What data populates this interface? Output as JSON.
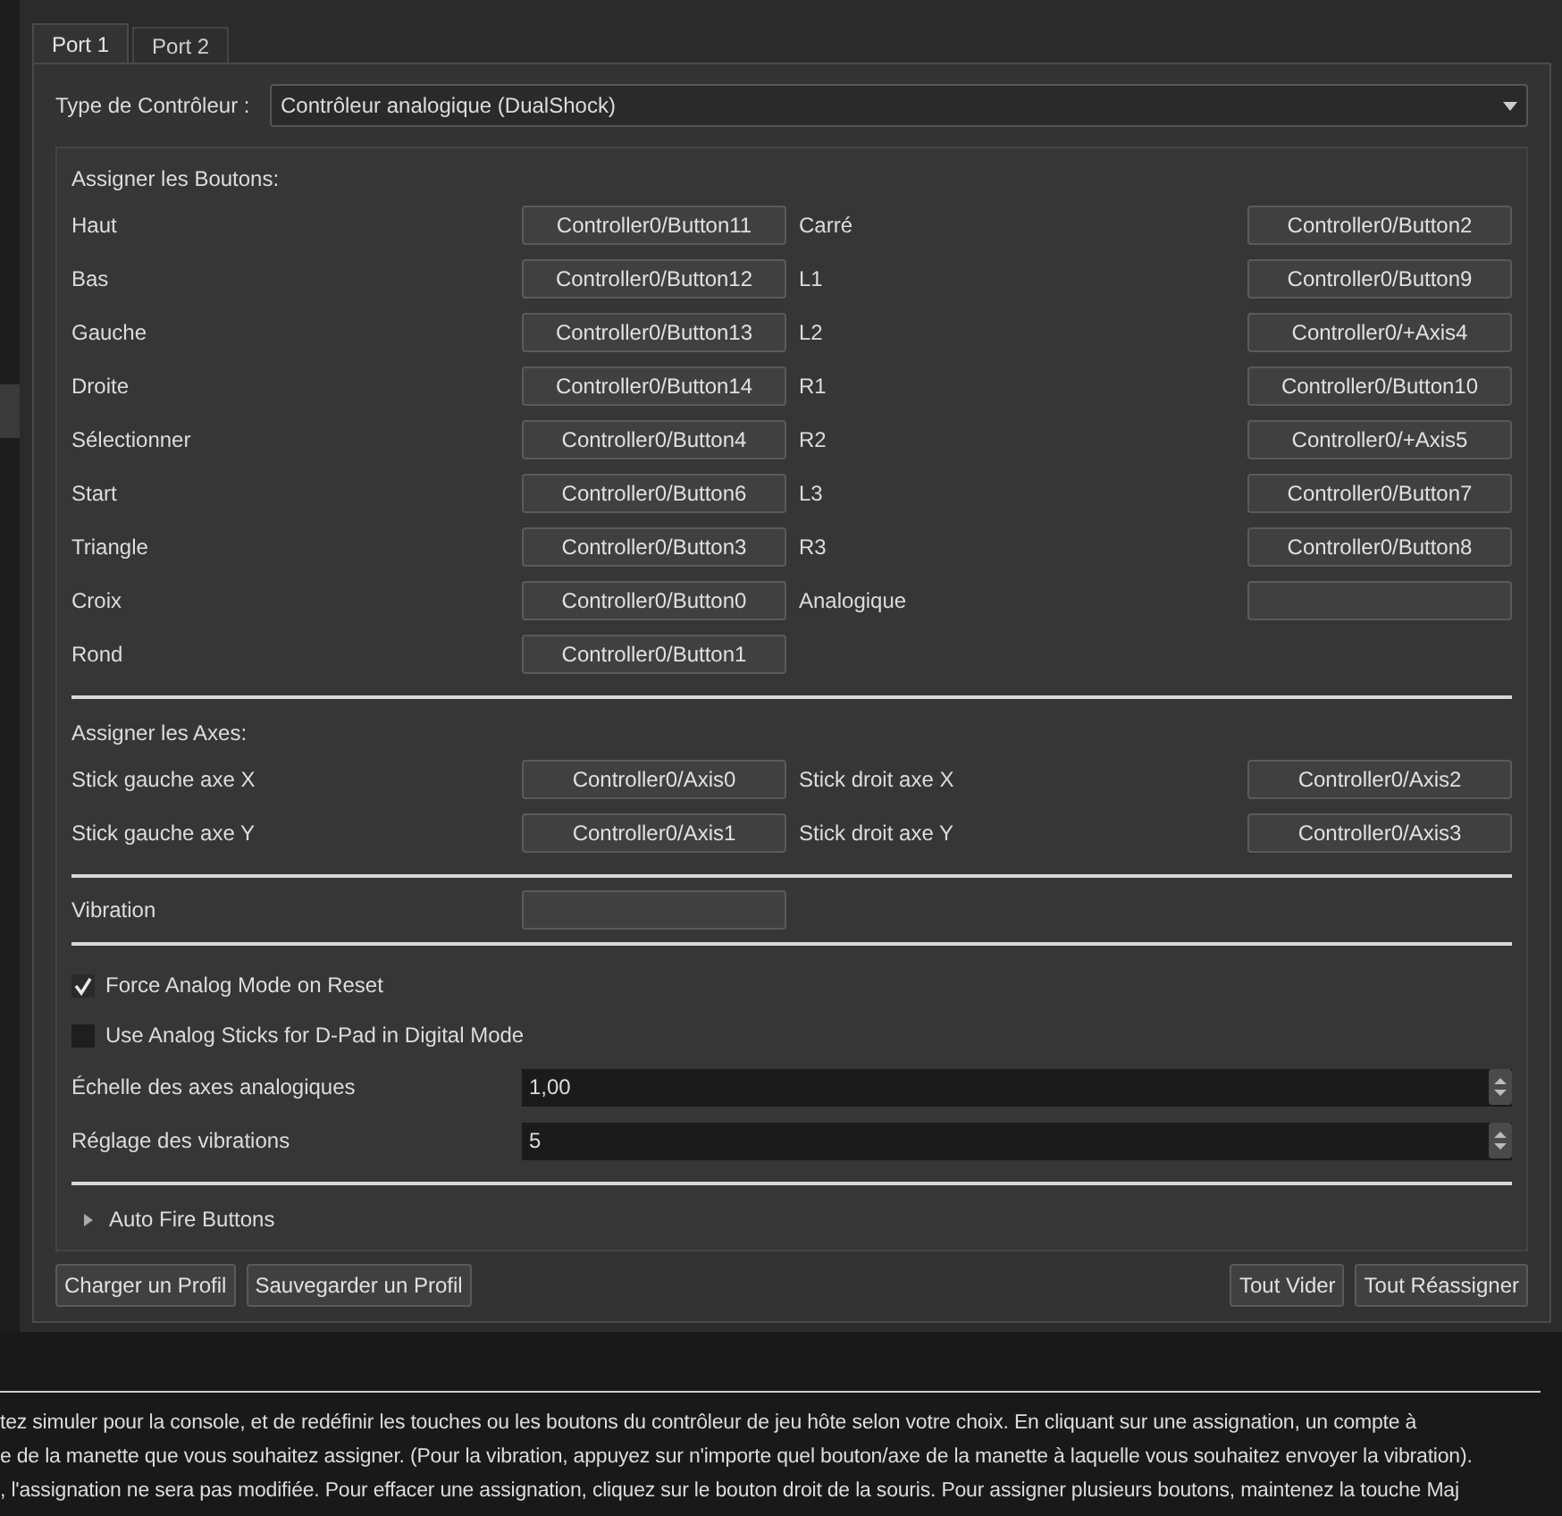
{
  "tabs": [
    {
      "label": "Port 1",
      "selected": true
    },
    {
      "label": "Port 2",
      "selected": false
    }
  ],
  "controller_type": {
    "label": "Type de Contrôleur :",
    "value": "Contrôleur analogique (DualShock)"
  },
  "buttons_section": {
    "title": "Assigner les Boutons:",
    "left": [
      {
        "label": "Haut",
        "value": "Controller0/Button11"
      },
      {
        "label": "Bas",
        "value": "Controller0/Button12"
      },
      {
        "label": "Gauche",
        "value": "Controller0/Button13"
      },
      {
        "label": "Droite",
        "value": "Controller0/Button14"
      },
      {
        "label": "Sélectionner",
        "value": "Controller0/Button4"
      },
      {
        "label": "Start",
        "value": "Controller0/Button6"
      },
      {
        "label": "Triangle",
        "value": "Controller0/Button3"
      },
      {
        "label": "Croix",
        "value": "Controller0/Button0"
      },
      {
        "label": "Rond",
        "value": "Controller0/Button1"
      }
    ],
    "right": [
      {
        "label": "Carré",
        "value": "Controller0/Button2"
      },
      {
        "label": "L1",
        "value": "Controller0/Button9"
      },
      {
        "label": "L2",
        "value": "Controller0/+Axis4"
      },
      {
        "label": "R1",
        "value": "Controller0/Button10"
      },
      {
        "label": "R2",
        "value": "Controller0/+Axis5"
      },
      {
        "label": "L3",
        "value": "Controller0/Button7"
      },
      {
        "label": "R3",
        "value": "Controller0/Button8"
      },
      {
        "label": "Analogique"
      }
    ]
  },
  "axes_section": {
    "title": "Assigner les Axes:",
    "left": [
      {
        "label": "Stick gauche axe X",
        "value": "Controller0/Axis0"
      },
      {
        "label": "Stick gauche axe Y",
        "value": "Controller0/Axis1"
      }
    ],
    "right": [
      {
        "label": "Stick droit axe X",
        "value": "Controller0/Axis2"
      },
      {
        "label": "Stick droit axe Y",
        "value": "Controller0/Axis3"
      }
    ]
  },
  "vibration": {
    "label": "Vibration"
  },
  "options": [
    {
      "label": "Force Analog Mode on Reset",
      "checked": true
    },
    {
      "label": "Use Analog Sticks for D-Pad in Digital Mode",
      "checked": false
    }
  ],
  "spinboxes": [
    {
      "label": "Échelle des axes analogiques",
      "value": "1,00"
    },
    {
      "label": "Réglage des vibrations",
      "value": "5"
    }
  ],
  "auto_fire": {
    "label": "Auto Fire Buttons",
    "expanded": false
  },
  "footer_buttons_left": [
    "Charger un Profil",
    "Sauvegarder un Profil"
  ],
  "footer_buttons_right": [
    "Tout Vider",
    "Tout Réassigner"
  ],
  "help_lines": [
    "tez simuler pour la console, et de redéfinir les touches ou les boutons du contrôleur de jeu hôte selon votre choix. En cliquant sur une assignation, un compte à",
    "e de la manette que vous souhaitez assigner. (Pour la vibration, appuyez sur n'importe quel bouton/axe de la manette à laquelle vous souhaitez envoyer la vibration).",
    ", l'assignation ne sera pas modifiée. Pour effacer une assignation, cliquez sur le bouton droit de la souris. Pour assigner plusieurs boutons, maintenez la touche Maj"
  ]
}
